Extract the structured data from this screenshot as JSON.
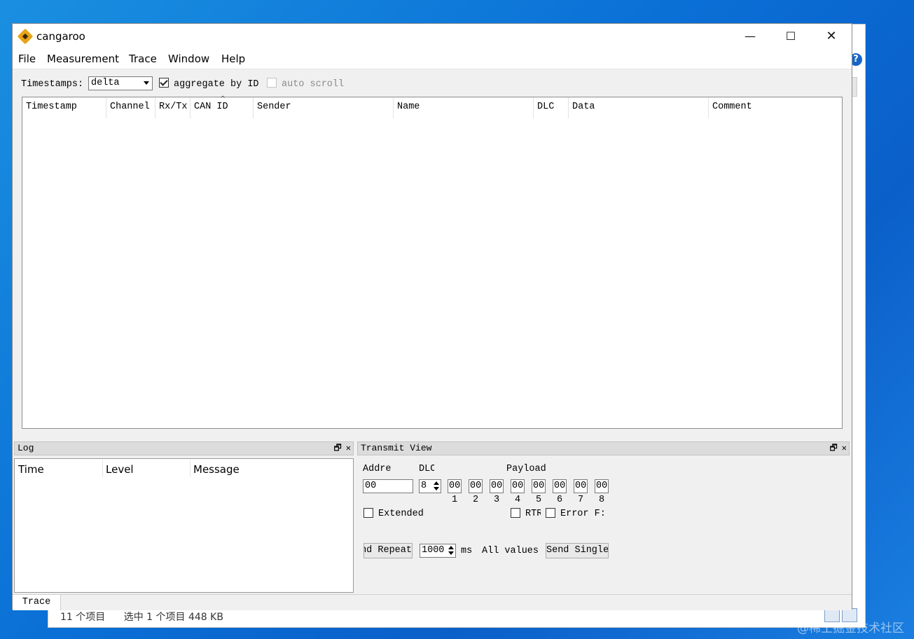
{
  "background": {
    "status_items": [
      "11 个项目",
      "选中 1 个项目  448 KB"
    ],
    "help_icon": "?",
    "watermark": "@稀土掘金技术社区"
  },
  "window": {
    "title": "cangaroo",
    "logo_icon": "kangaroo-logo-icon",
    "minimize": "—",
    "maximize": "☐",
    "close": "✕"
  },
  "menu": [
    "File",
    "Measurement",
    "Trace",
    "Window",
    "Help"
  ],
  "toolbar": {
    "timestamps_label": "Timestamps:",
    "timestamps_value": "delta",
    "aggregate_label": "aggregate by ID",
    "aggregate_checked": true,
    "autoscroll_label": "auto scroll",
    "autoscroll_checked": false
  },
  "trace": {
    "columns": [
      "Timestamp",
      "Channel",
      "Rx/Tx",
      "CAN ID",
      "Sender",
      "Name",
      "DLC",
      "Data",
      "Comment"
    ],
    "sort_indicator": "^",
    "rows": []
  },
  "log": {
    "title": "Log",
    "columns": [
      "Time",
      "Level",
      "Message"
    ],
    "float_icon": "🗗",
    "close_icon": "✕"
  },
  "transmit": {
    "title": "Transmit View",
    "address_label": "Addre",
    "address_value": "00",
    "dlc_label": "DLC",
    "dlc_value": "8",
    "payload_label": "Payload",
    "payload_values": [
      "00",
      "00",
      "00",
      "00",
      "00",
      "00",
      "00",
      "00"
    ],
    "payload_indices": [
      "1",
      "2",
      "3",
      "4",
      "5",
      "6",
      "7",
      "8"
    ],
    "extended_label": "Extended",
    "rtr_label": "RTR",
    "error_label": "Error F:",
    "send_repeat_label": "Send Repeat",
    "interval_value": "1000",
    "ms_label": "ms",
    "all_values_label": "All values",
    "send_single_label": "Send Single",
    "float_icon": "🗗",
    "close_icon": "✕"
  },
  "tabs": [
    "Trace"
  ]
}
